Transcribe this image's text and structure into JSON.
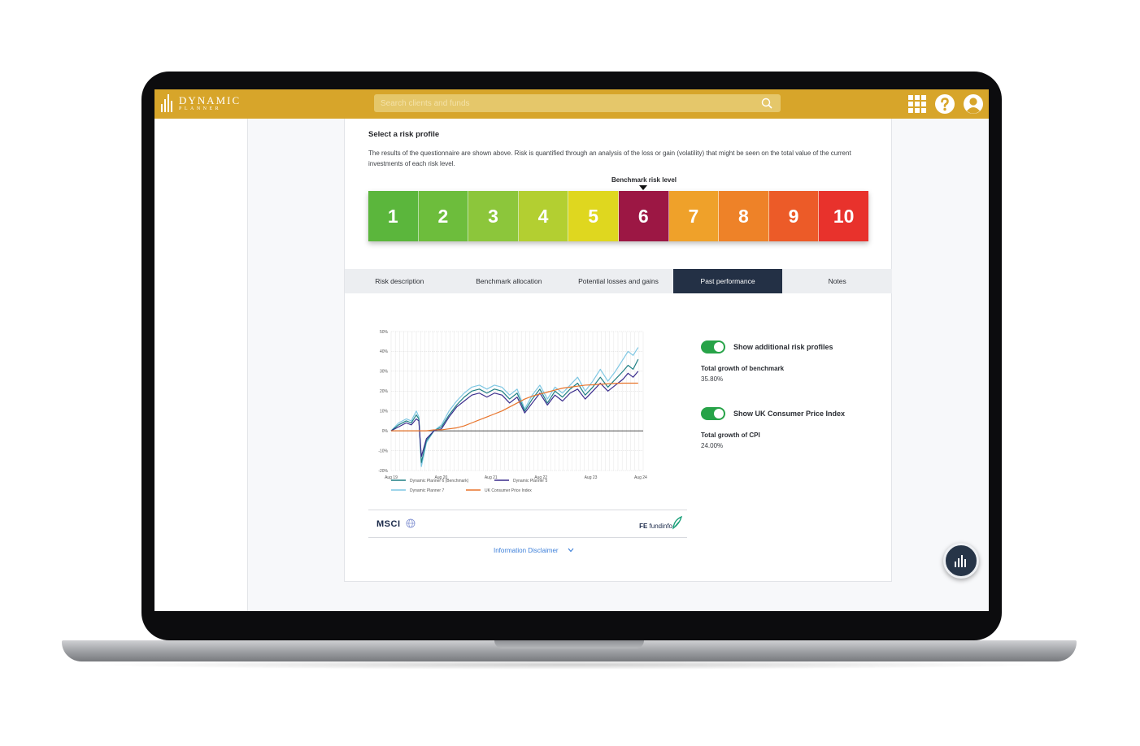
{
  "app": {
    "logo_main": "DYNAMIC",
    "logo_sub": "PLANNER",
    "search_placeholder": "Search clients and funds"
  },
  "risk_profile": {
    "title": "Select a risk profile",
    "description": "The results of the questionnaire are shown above. Risk is quantified through an analysis of the loss or gain (volatility) that might be seen on the total value of the current investments of each risk level.",
    "benchmark_label": "Benchmark risk level",
    "selected_level": 6,
    "levels": [
      {
        "label": "1",
        "color": "#5bb63c"
      },
      {
        "label": "2",
        "color": "#6dbd3c"
      },
      {
        "label": "3",
        "color": "#8cc63b"
      },
      {
        "label": "4",
        "color": "#b3cf31"
      },
      {
        "label": "5",
        "color": "#dfd71f"
      },
      {
        "label": "6",
        "color": "#9c1744"
      },
      {
        "label": "7",
        "color": "#efa12a"
      },
      {
        "label": "8",
        "color": "#ee8228"
      },
      {
        "label": "9",
        "color": "#ec5b28"
      },
      {
        "label": "10",
        "color": "#e8322c"
      }
    ]
  },
  "tabs": [
    {
      "label": "Risk description",
      "active": false
    },
    {
      "label": "Benchmark allocation",
      "active": false
    },
    {
      "label": "Potential losses and gains",
      "active": false
    },
    {
      "label": "Past performance",
      "active": true
    },
    {
      "label": "Notes",
      "active": false
    }
  ],
  "controls": {
    "toggle1_label": "Show additional risk profiles",
    "toggle1_on": true,
    "stat1_label": "Total growth of benchmark",
    "stat1_value": "35.80%",
    "toggle2_label": "Show UK Consumer Price Index",
    "toggle2_on": true,
    "stat2_label": "Total growth of CPI",
    "stat2_value": "24.00%"
  },
  "providers": {
    "msci": "MSCI",
    "fe_prefix": "FE",
    "fe_name": "fundinfo"
  },
  "disclaimer": "Information Disclaimer",
  "chart_data": {
    "type": "line",
    "y_ticks": [
      "50%",
      "40%",
      "30%",
      "20%",
      "10%",
      "0%",
      "-10%",
      "-20%"
    ],
    "x_ticks": [
      "Aug 19",
      "Aug 20",
      "Aug 21",
      "Aug 22",
      "Aug 23",
      "Aug 24"
    ],
    "ylim": [
      -20,
      50
    ],
    "grid": true,
    "x": [
      2019.6,
      2019.75,
      2019.9,
      2020.0,
      2020.1,
      2020.15,
      2020.2,
      2020.3,
      2020.45,
      2020.6,
      2020.75,
      2020.9,
      2021.05,
      2021.2,
      2021.35,
      2021.5,
      2021.65,
      2021.8,
      2021.95,
      2022.1,
      2022.25,
      2022.4,
      2022.55,
      2022.7,
      2022.85,
      2023.0,
      2023.15,
      2023.3,
      2023.45,
      2023.6,
      2023.75,
      2023.9,
      2024.05,
      2024.2,
      2024.3,
      2024.4,
      2024.5
    ],
    "series": [
      {
        "name": "Dynamic Planner 6 (Benchmark)",
        "color": "#1f7f84",
        "values": [
          0,
          3,
          5,
          4,
          8,
          6,
          -16,
          -5,
          0,
          2,
          8,
          13,
          17,
          20,
          21,
          19,
          21,
          20,
          16,
          19,
          10,
          16,
          21,
          14,
          20,
          17,
          21,
          24,
          18,
          22,
          27,
          22,
          26,
          30,
          33,
          31,
          36
        ]
      },
      {
        "name": "Dynamic Planner 5",
        "color": "#3a2c8c",
        "values": [
          0,
          2,
          4,
          3,
          6,
          5,
          -13,
          -4,
          0,
          1,
          7,
          12,
          15,
          18,
          19,
          17,
          19,
          18,
          14,
          17,
          9,
          14,
          19,
          13,
          18,
          15,
          19,
          21,
          16,
          20,
          24,
          20,
          23,
          26,
          29,
          27,
          30
        ]
      },
      {
        "name": "Dynamic Planner 7",
        "color": "#7fc7e3",
        "values": [
          0,
          4,
          6,
          5,
          10,
          7,
          -18,
          -6,
          0,
          3,
          10,
          15,
          19,
          22,
          23,
          21,
          23,
          22,
          18,
          21,
          11,
          18,
          23,
          16,
          22,
          19,
          23,
          27,
          20,
          25,
          31,
          25,
          30,
          36,
          40,
          38,
          42
        ]
      },
      {
        "name": "UK Consumer Price Index",
        "color": "#e8742b",
        "values": [
          0,
          0,
          0,
          0,
          0,
          0,
          0,
          0,
          0.5,
          0.5,
          1,
          1.5,
          2.5,
          4,
          5.5,
          7,
          8.5,
          10,
          12,
          14,
          16,
          17.5,
          18.5,
          19.5,
          20.5,
          21.5,
          22,
          22.5,
          23,
          23.2,
          23.5,
          23.7,
          23.9,
          24,
          24,
          24,
          24
        ]
      }
    ]
  }
}
